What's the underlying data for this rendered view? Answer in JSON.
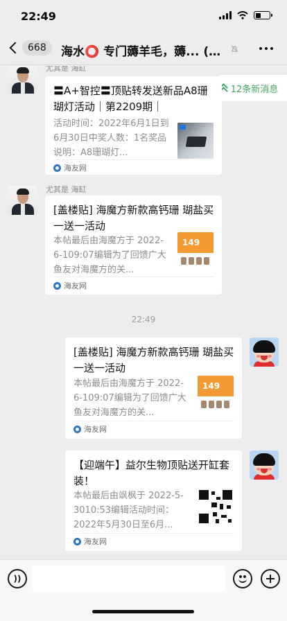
{
  "status_bar": {
    "time": "22:49"
  },
  "nav": {
    "unread_count": "668",
    "title": "海水⭕ 专门薅羊毛，薅... (16)"
  },
  "new_messages_banner": "12条新消息",
  "messages": [
    {
      "sender_name": "尤其是 海缸",
      "title": "〓A+智控〓顶贴转发送新品A8珊 瑚灯活动｜第2209期｜",
      "description": "活动时间：2022年6月1日到6月30日中奖人数：1名奖品说明：A8珊瑚灯...",
      "source": "海友网"
    },
    {
      "sender_name": "尤其是 海缸",
      "title": "[盖楼贴] 海魔方新款高钙珊 瑚盐买一送一活动",
      "description": "本帖最后由海魔方于 2022-6-109:07编辑为了回馈广大鱼友对海魔方的关...",
      "source": "海友网"
    },
    {
      "title": "[盖楼贴] 海魔方新款高钙珊 瑚盐买一送一活动",
      "description": "本帖最后由海魔方于 2022-6-109:07编辑为了回馈广大鱼友对海魔方的关...",
      "source": "海友网"
    },
    {
      "title": "【迎端午】益尔生物顶贴送开缸套装！",
      "description": "本帖最后由飒枫于 2022-5-3010:53编辑活动时间：2022年5月30日至6月...",
      "source": "海友网"
    }
  ],
  "time_divider": "22:49",
  "thumbnail_number": "149",
  "input_bar": {
    "voice_label": "))"
  }
}
